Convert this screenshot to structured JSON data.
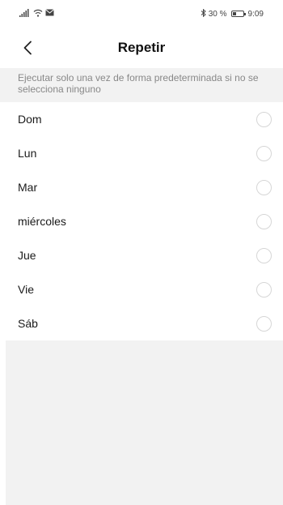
{
  "status_bar": {
    "signal_icon": "signal-icon",
    "wifi_icon": "wifi-icon",
    "mail_icon": "mail-icon",
    "bluetooth_icon": "bluetooth-icon",
    "battery_text": "30 %",
    "time": "9:09"
  },
  "header": {
    "back_icon": "chevron-left-icon",
    "title": "Repetir"
  },
  "hint": {
    "text": "Ejecutar solo una vez de forma predeterminada si no se selecciona ninguno"
  },
  "days": [
    {
      "label": "Dom",
      "selected": false
    },
    {
      "label": "Lun",
      "selected": false
    },
    {
      "label": "Mar",
      "selected": false
    },
    {
      "label": "miércoles",
      "selected": false
    },
    {
      "label": "Jue",
      "selected": false
    },
    {
      "label": "Vie",
      "selected": false
    },
    {
      "label": "Sáb",
      "selected": false
    }
  ],
  "colors": {
    "background": "#ffffff",
    "hint_background": "#f2f2f2",
    "hint_text": "#888888",
    "radio_border": "#d6d6d6"
  }
}
